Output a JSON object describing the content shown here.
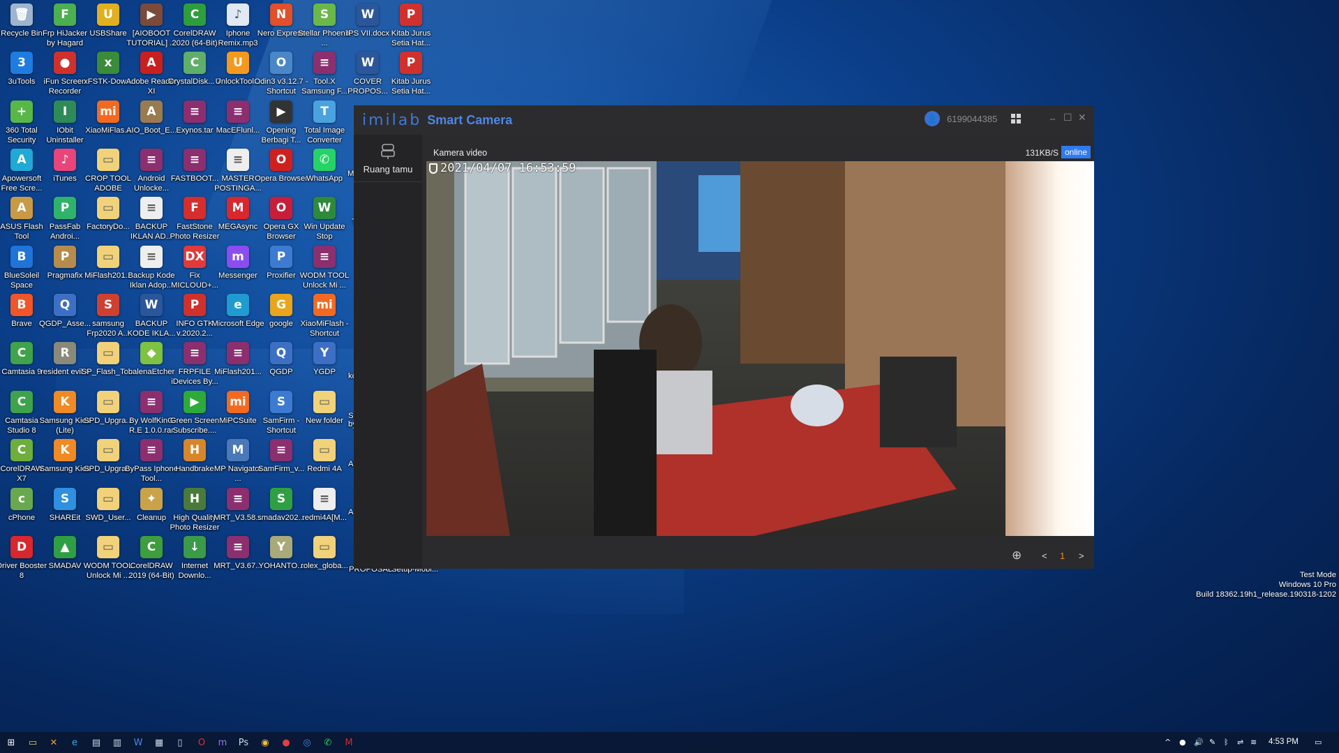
{
  "desktop": {
    "icons": [
      {
        "label": "Recycle Bin",
        "icon": "recycle-bin-icon",
        "color": "#9fb4cf",
        "glyph": "🗑"
      },
      {
        "label": "Frp HiJacker by Hagard",
        "icon": "frp-hijacker-icon",
        "color": "#4caf50",
        "glyph": "F"
      },
      {
        "label": "USBShare",
        "icon": "usbshare-icon",
        "color": "#e0b020",
        "glyph": "U"
      },
      {
        "label": "[AIOBOOT TUTORIAL] ...",
        "icon": "video-file-icon",
        "color": "#7a4a3a",
        "glyph": "▶"
      },
      {
        "label": "CorelDRAW 2020 (64-Bit)",
        "icon": "coreldraw-icon",
        "color": "#2e9d3d",
        "glyph": "C"
      },
      {
        "label": "Iphone Remix.mp3",
        "icon": "mp3-file-icon",
        "color": "#dfe8f3",
        "glyph": "♪"
      },
      {
        "label": "Nero Express",
        "icon": "nero-icon",
        "color": "#e0502a",
        "glyph": "N"
      },
      {
        "label": "Stellar Phoenix ...",
        "icon": "stellar-icon",
        "color": "#6bb84a",
        "glyph": "S"
      },
      {
        "label": "IPS VII.docx",
        "icon": "word-doc-icon",
        "color": "#2b579a",
        "glyph": "W"
      },
      {
        "label": "Kitab Jurus Setia Hat...",
        "icon": "pdf-icon",
        "color": "#d0312d",
        "glyph": "P"
      },
      {
        "label": "3uTools",
        "icon": "3utools-icon",
        "color": "#1e7ce0",
        "glyph": "3"
      },
      {
        "label": "iFun Screen Recorder",
        "icon": "ifun-recorder-icon",
        "color": "#d0312d",
        "glyph": "●"
      },
      {
        "label": "xFSTK-Dow...",
        "icon": "xfstk-icon",
        "color": "#3a8b3a",
        "glyph": "x"
      },
      {
        "label": "Adobe Reader XI",
        "icon": "adobe-reader-icon",
        "color": "#c8201e",
        "glyph": "A"
      },
      {
        "label": "CrystalDisk... 7",
        "icon": "crystaldisk-icon",
        "color": "#5fae6a",
        "glyph": "C"
      },
      {
        "label": "UnlockTool...",
        "icon": "unlocktool-icon",
        "color": "#f39a1e",
        "glyph": "U"
      },
      {
        "label": "Odin3 v3.12.7 - Shortcut",
        "icon": "odin-icon",
        "color": "#4a87c8",
        "glyph": "O"
      },
      {
        "label": "Tool.X Samsung F...",
        "icon": "winrar-icon",
        "color": "#8b2f6f",
        "glyph": "≡"
      },
      {
        "label": "COVER PROPOS...",
        "icon": "word-doc-icon",
        "color": "#2b579a",
        "glyph": "W"
      },
      {
        "label": "Kitab Jurus Setia Hat...",
        "icon": "pdf-icon",
        "color": "#d0312d",
        "glyph": "P"
      },
      {
        "label": "360 Total Security",
        "icon": "360-security-icon",
        "color": "#57b847",
        "glyph": "+"
      },
      {
        "label": "IObit Uninstaller",
        "icon": "iobit-icon",
        "color": "#2e8b57",
        "glyph": "I"
      },
      {
        "label": "XiaoMiFlas...",
        "icon": "xiaomi-flash-icon",
        "color": "#f26a21",
        "glyph": "mi"
      },
      {
        "label": "AIO_Boot_E...",
        "icon": "aio-boot-icon",
        "color": "#9a7b4f",
        "glyph": "A"
      },
      {
        "label": "Exynos.tar",
        "icon": "winrar-icon",
        "color": "#8b2f6f",
        "glyph": "≡"
      },
      {
        "label": "MacEFlunl...",
        "icon": "winrar-icon",
        "color": "#8b2f6f",
        "glyph": "≡"
      },
      {
        "label": "Opening Berbagi T...",
        "icon": "video-file-icon",
        "color": "#333333",
        "glyph": "▶"
      },
      {
        "label": "Total Image Converter",
        "icon": "image-converter-icon",
        "color": "#4aa3df",
        "glyph": "T"
      },
      {
        "label": "Apowersoft Free Scre...",
        "icon": "apowersoft-icon",
        "color": "#1fa9d6",
        "glyph": "A"
      },
      {
        "label": "iTunes",
        "icon": "itunes-icon",
        "color": "#e8457a",
        "glyph": "♪"
      },
      {
        "label": "CROP TOOL ADOBE",
        "icon": "folder-icon",
        "color": "#f1d27a",
        "glyph": "▭"
      },
      {
        "label": "Android Unlocke...",
        "icon": "winrar-icon",
        "color": "#8b2f6f",
        "glyph": "≡"
      },
      {
        "label": "FASTBOOT...",
        "icon": "winrar-icon",
        "color": "#8b2f6f",
        "glyph": "≡"
      },
      {
        "label": "MASTER POSTINGA...",
        "icon": "text-file-icon",
        "color": "#eeeeee",
        "glyph": "≡"
      },
      {
        "label": "Opera Browser",
        "icon": "opera-icon",
        "color": "#d0201e",
        "glyph": "O"
      },
      {
        "label": "WhatsApp",
        "icon": "whatsapp-icon",
        "color": "#25d366",
        "glyph": "✆"
      },
      {
        "label": "ASUS Flash Tool",
        "icon": "asus-flash-icon",
        "color": "#c99a45",
        "glyph": "A"
      },
      {
        "label": "PassFab Androi...",
        "icon": "passfab-icon",
        "color": "#2fb36b",
        "glyph": "P"
      },
      {
        "label": "FactoryDo...",
        "icon": "folder-icon",
        "color": "#f1d27a",
        "glyph": "▭"
      },
      {
        "label": "BACKUP IKLAN AD...",
        "icon": "text-file-icon",
        "color": "#eeeeee",
        "glyph": "≡"
      },
      {
        "label": "FastStone Photo Resizer",
        "icon": "faststone-icon",
        "color": "#d62d2d",
        "glyph": "F"
      },
      {
        "label": "MEGAsync",
        "icon": "megasync-icon",
        "color": "#d9272e",
        "glyph": "M"
      },
      {
        "label": "Opera GX Browser",
        "icon": "opera-gx-icon",
        "color": "#c81e3a",
        "glyph": "O"
      },
      {
        "label": "Win Update Stop",
        "icon": "win-update-stop-icon",
        "color": "#2d8a3a",
        "glyph": "W"
      },
      {
        "label": "BlueSoleil Space",
        "icon": "bluesoleil-icon",
        "color": "#1e74d8",
        "glyph": "B"
      },
      {
        "label": "Pragmafix",
        "icon": "pragmafix-icon",
        "color": "#b58c4c",
        "glyph": "P"
      },
      {
        "label": "MiFlash201...",
        "icon": "folder-icon",
        "color": "#f1d27a",
        "glyph": "▭"
      },
      {
        "label": "Backup Kode Iklan Adop...",
        "icon": "text-file-icon",
        "color": "#eeeeee",
        "glyph": "≡"
      },
      {
        "label": "Fix MICLOUD+...",
        "icon": "fix-micloud-icon",
        "color": "#e23a3a",
        "glyph": "DX"
      },
      {
        "label": "Messenger",
        "icon": "messenger-icon",
        "color": "#8a4df0",
        "glyph": "m"
      },
      {
        "label": "Proxifier",
        "icon": "proxifier-icon",
        "color": "#3c7bd1",
        "glyph": "P"
      },
      {
        "label": "WODM TOOL Unlock Mi ...",
        "icon": "winrar-icon",
        "color": "#8b2f6f",
        "glyph": "≡"
      },
      {
        "label": "Brave",
        "icon": "brave-icon",
        "color": "#f0562a",
        "glyph": "B"
      },
      {
        "label": "QGDP_Asse...",
        "icon": "qgdp-icon",
        "color": "#3d6fc4",
        "glyph": "Q"
      },
      {
        "label": "samsung Frp2020 A...",
        "icon": "samsung-frp-icon",
        "color": "#d04030",
        "glyph": "S"
      },
      {
        "label": "BACKUP KODE IKLA...",
        "icon": "word-doc-icon",
        "color": "#2b579a",
        "glyph": "W"
      },
      {
        "label": "INFO GTK v.2020.2...",
        "icon": "pdf-icon",
        "color": "#d0312d",
        "glyph": "P"
      },
      {
        "label": "Microsoft Edge",
        "icon": "edge-icon",
        "color": "#1f9bd1",
        "glyph": "e"
      },
      {
        "label": "google",
        "icon": "chrome-icon",
        "color": "#e9a51c",
        "glyph": "G"
      },
      {
        "label": "XiaoMiFlash - Shortcut",
        "icon": "xiaomi-flash-icon",
        "color": "#f26a21",
        "glyph": "mi"
      },
      {
        "label": "Camtasia 9",
        "icon": "camtasia-icon",
        "color": "#3ea34a",
        "glyph": "C"
      },
      {
        "label": "resident evil 4",
        "icon": "re4-icon",
        "color": "#8a8a7a",
        "glyph": "R"
      },
      {
        "label": "SP_Flash_To...",
        "icon": "folder-icon",
        "color": "#f1d27a",
        "glyph": "▭"
      },
      {
        "label": "balenaEtcher",
        "icon": "balenaetcher-icon",
        "color": "#7ec242",
        "glyph": "◆"
      },
      {
        "label": "FRPFILE iDevices By...",
        "icon": "winrar-icon",
        "color": "#8b2f6f",
        "glyph": "≡"
      },
      {
        "label": "MiFlash201...",
        "icon": "winrar-icon",
        "color": "#8b2f6f",
        "glyph": "≡"
      },
      {
        "label": "QGDP",
        "icon": "qgdp-icon",
        "color": "#3d6fc4",
        "glyph": "Q"
      },
      {
        "label": "YGDP",
        "icon": "ygdp-icon",
        "color": "#3d6fc4",
        "glyph": "Y"
      },
      {
        "label": "Camtasia Studio 8",
        "icon": "camtasia-icon",
        "color": "#3ea34a",
        "glyph": "C"
      },
      {
        "label": "Samsung Kies (Lite)",
        "icon": "samsung-kies-icon",
        "color": "#f08a24",
        "glyph": "K"
      },
      {
        "label": "SPD_Upgra...",
        "icon": "folder-icon",
        "color": "#f1d27a",
        "glyph": "▭"
      },
      {
        "label": "By WolfKinG R.E 1.0.0.rar",
        "icon": "winrar-icon",
        "color": "#8b2f6f",
        "glyph": "≡"
      },
      {
        "label": "Green Screen Subscribe....",
        "icon": "video-file-icon",
        "color": "#2eaa3a",
        "glyph": "▶"
      },
      {
        "label": "MiPCSuite",
        "icon": "mipcsuite-icon",
        "color": "#f26a21",
        "glyph": "mi"
      },
      {
        "label": "SamFirm - Shortcut",
        "icon": "samfirm-icon",
        "color": "#3c7bd1",
        "glyph": "S"
      },
      {
        "label": "New folder",
        "icon": "folder-icon",
        "color": "#f1d27a",
        "glyph": "▭"
      },
      {
        "label": "CorelDRAW X7",
        "icon": "coreldraw-icon",
        "color": "#6dae3c",
        "glyph": "C"
      },
      {
        "label": "Samsung Kies",
        "icon": "samsung-kies-icon",
        "color": "#f08a24",
        "glyph": "K"
      },
      {
        "label": "SPD_Upgra...",
        "icon": "folder-icon",
        "color": "#f1d27a",
        "glyph": "▭"
      },
      {
        "label": "ByPass Iphone Tool...",
        "icon": "winrar-icon",
        "color": "#8b2f6f",
        "glyph": "≡"
      },
      {
        "label": "Handbrake",
        "icon": "handbrake-icon",
        "color": "#d8862a",
        "glyph": "H"
      },
      {
        "label": "MP Navigator ...",
        "icon": "mp-navigator-icon",
        "color": "#4a78b8",
        "glyph": "M"
      },
      {
        "label": "SamFirm_v...",
        "icon": "winrar-icon",
        "color": "#8b2f6f",
        "glyph": "≡"
      },
      {
        "label": "Redmi 4A",
        "icon": "folder-icon",
        "color": "#f1d27a",
        "glyph": "▭"
      },
      {
        "label": "cPhone",
        "icon": "cphone-icon",
        "color": "#6aa84f",
        "glyph": "c"
      },
      {
        "label": "SHAREit",
        "icon": "shareit-icon",
        "color": "#2f8fe0",
        "glyph": "S"
      },
      {
        "label": "SWD_User...",
        "icon": "folder-icon",
        "color": "#f1d27a",
        "glyph": "▭"
      },
      {
        "label": "Cleanup",
        "icon": "cleanup-icon",
        "color": "#c9a24a",
        "glyph": "✦"
      },
      {
        "label": "High Quality Photo Resizer",
        "icon": "photo-resizer-icon",
        "color": "#4a7a3a",
        "glyph": "H"
      },
      {
        "label": "MRT_V3.58...",
        "icon": "winrar-icon",
        "color": "#8b2f6f",
        "glyph": "≡"
      },
      {
        "label": "smadav202...",
        "icon": "smadav-icon",
        "color": "#2ea043",
        "glyph": "S"
      },
      {
        "label": "redmi4A[M...",
        "icon": "text-file-icon",
        "color": "#eeeeee",
        "glyph": "≡"
      },
      {
        "label": "Driver Booster 8",
        "icon": "driver-booster-icon",
        "color": "#d9272e",
        "glyph": "D"
      },
      {
        "label": "SMADAV",
        "icon": "smadav-icon",
        "color": "#2ea043",
        "glyph": "▲"
      },
      {
        "label": "WODM TOOL Unlock Mi ...",
        "icon": "folder-icon",
        "color": "#f1d27a",
        "glyph": "▭"
      },
      {
        "label": "CorelDRAW 2019 (64-Bit)",
        "icon": "coreldraw-icon",
        "color": "#3e9d3d",
        "glyph": "C"
      },
      {
        "label": "Internet Downlo...",
        "icon": "idm-icon",
        "color": "#3a9b48",
        "glyph": "↓"
      },
      {
        "label": "MRT_V3.67...",
        "icon": "winrar-icon",
        "color": "#8b2f6f",
        "glyph": "≡"
      },
      {
        "label": "YOHANTO...",
        "icon": "yohanto-icon",
        "color": "#a9a979",
        "glyph": "Y"
      },
      {
        "label": "rolex_globa...",
        "icon": "folder-icon",
        "color": "#f1d27a",
        "glyph": "▭"
      }
    ],
    "partial_labels": [
      "M",
      "T",
      "kc",
      "Sa by",
      "Ac",
      "A",
      "PROPOSAL...",
      "Setup-Mobi..."
    ]
  },
  "window": {
    "brand": "imilab",
    "app_name": "Smart Camera",
    "user_id": "6199044385",
    "controls": {
      "minimize": "_",
      "maximize": "☐",
      "close": "✕"
    },
    "sidebar": {
      "room_name": "Ruang tamu"
    },
    "camera": {
      "title": "Kamera video",
      "bitrate": "131KB/S",
      "status": "online",
      "timestamp": "2021/04/07  16:53:59"
    },
    "footer": {
      "prev": "<",
      "page": "1",
      "next": ">"
    }
  },
  "watermark": {
    "line1": "Test Mode",
    "line2": "Windows 10 Pro",
    "line3": "Build 18362.19h1_release.190318-1202"
  },
  "taskbar": {
    "apps": [
      "start-icon",
      "file-explorer-icon",
      "tool-icon",
      "edge-icon",
      "scanner-icon",
      "phone-icon",
      "word-icon",
      "calculator-icon",
      "notepad-icon",
      "opera-icon",
      "messenger-icon",
      "photoshop-icon",
      "chrome-icon",
      "recorder-icon",
      "imilab-icon",
      "whatsapp-icon",
      "mega-icon"
    ],
    "clock": "4:53 PM"
  }
}
